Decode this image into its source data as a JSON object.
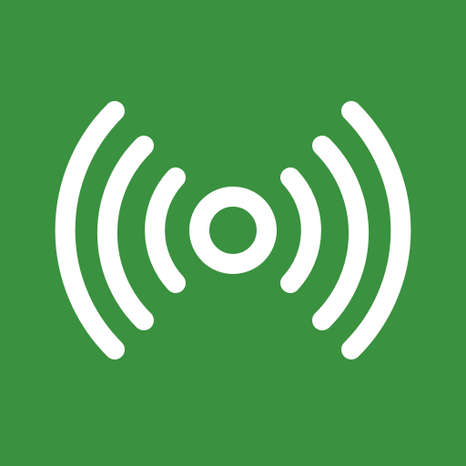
{
  "icon": {
    "name": "broadcast-signal-icon",
    "background_color": "#3a913f",
    "foreground_color": "#ffffff",
    "wave_rings_per_side": 3
  }
}
